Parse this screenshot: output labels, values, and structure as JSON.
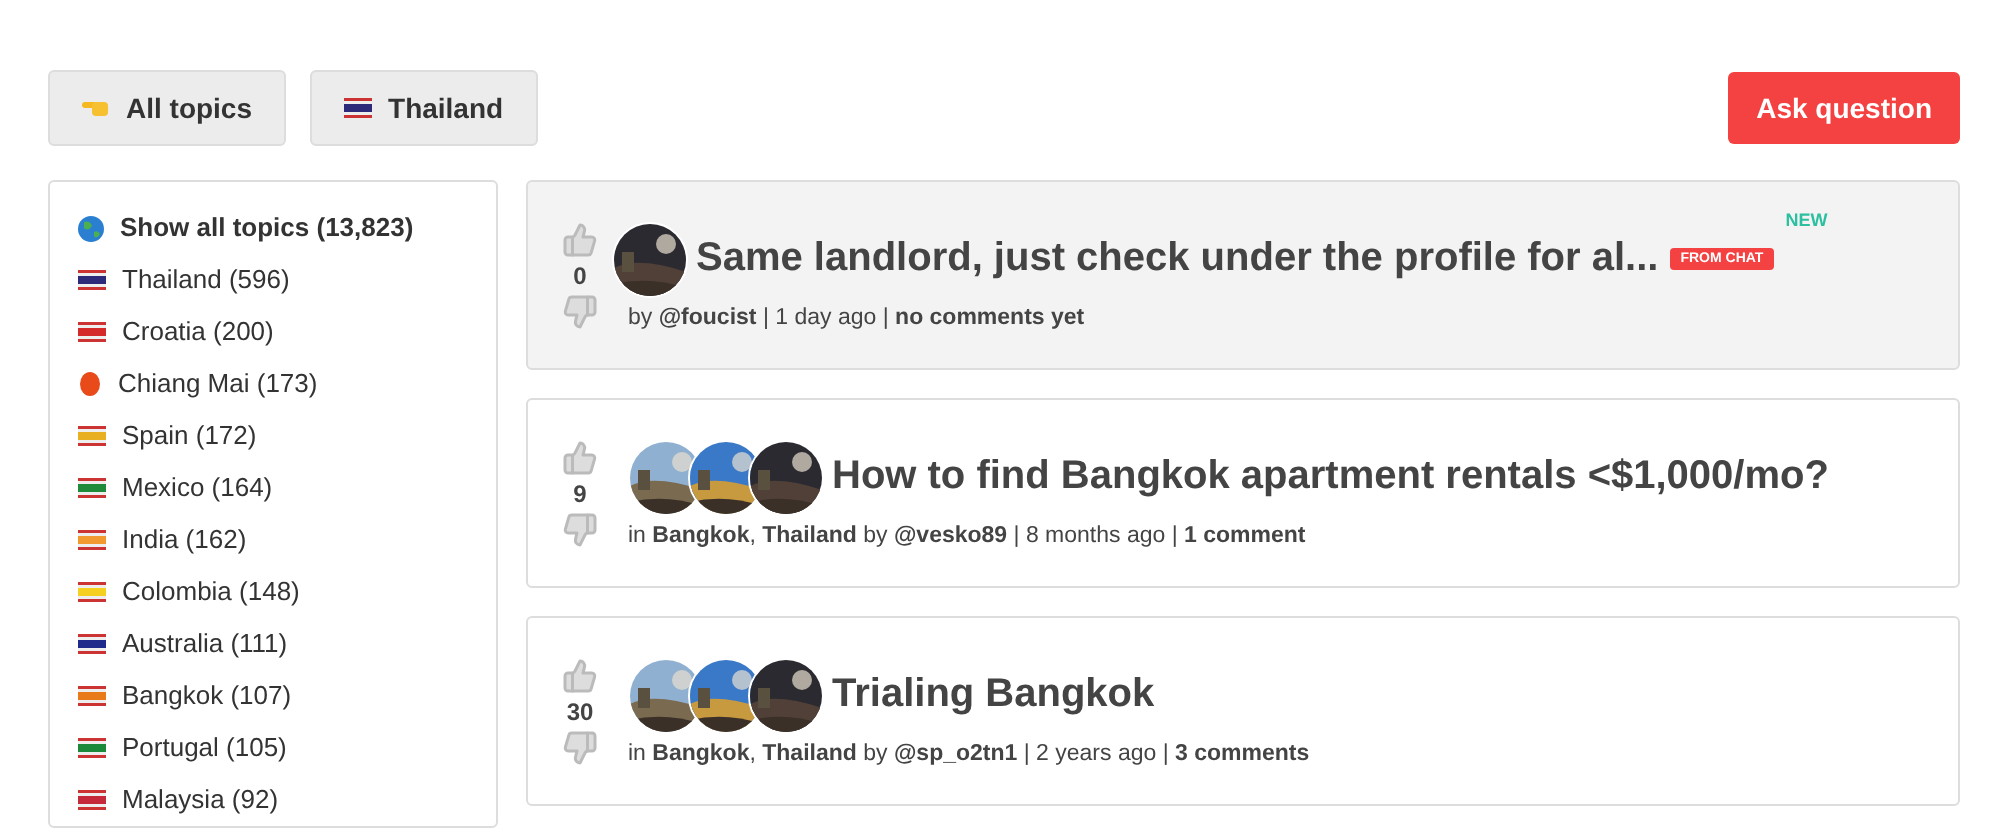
{
  "filters": [
    {
      "kind": "hand",
      "label": "All topics"
    },
    {
      "kind": "flag",
      "label": "Thailand",
      "color": "#2d2a7a"
    }
  ],
  "ask_button": "Ask question",
  "sidebar": {
    "items": [
      {
        "kind": "globe",
        "label": "Show all topics (13,823)",
        "color": "#2a7fd0",
        "selected": true
      },
      {
        "kind": "flag",
        "label": "Thailand (596)",
        "color": "#2d2a7a",
        "selected": false
      },
      {
        "kind": "flag",
        "label": "Croatia (200)",
        "color": "#d42a2a",
        "selected": false
      },
      {
        "kind": "lantern",
        "label": "Chiang Mai (173)",
        "color": "#e84a1a",
        "selected": false
      },
      {
        "kind": "flag",
        "label": "Spain (172)",
        "color": "#e8b020",
        "selected": false
      },
      {
        "kind": "flag",
        "label": "Mexico (164)",
        "color": "#1f8a3a",
        "selected": false
      },
      {
        "kind": "flag",
        "label": "India (162)",
        "color": "#f29a30",
        "selected": false
      },
      {
        "kind": "flag",
        "label": "Colombia (148)",
        "color": "#f5d020",
        "selected": false
      },
      {
        "kind": "flag",
        "label": "Australia (111)",
        "color": "#1f2a8a",
        "selected": false
      },
      {
        "kind": "flag",
        "label": "Bangkok (107)",
        "color": "#e87a1a",
        "selected": false
      },
      {
        "kind": "flag",
        "label": "Portugal (105)",
        "color": "#1a8a3a",
        "selected": false
      },
      {
        "kind": "flag",
        "label": "Malaysia (92)",
        "color": "#c42a3a",
        "selected": false
      }
    ]
  },
  "posts": [
    {
      "highlighted": true,
      "votes": "0",
      "title": "Same landlord, just check under the profile for al...",
      "badge": "FROM CHAT",
      "new_tag": "NEW",
      "meta": "by **@foucist** | 1 day ago | **no comments yet**"
    },
    {
      "highlighted": false,
      "votes": "9",
      "title": "How to find Bangkok apartment rentals <$1,000/mo?",
      "meta": "in **Bangkok**, **Thailand** by **@vesko89** | 8 months ago | **1 comment**"
    },
    {
      "highlighted": false,
      "votes": "30",
      "title": "Trialing Bangkok",
      "meta": "in **Bangkok**, **Thailand** by **@sp_o2tn1** | 2 years ago | **3 comments**"
    }
  ]
}
